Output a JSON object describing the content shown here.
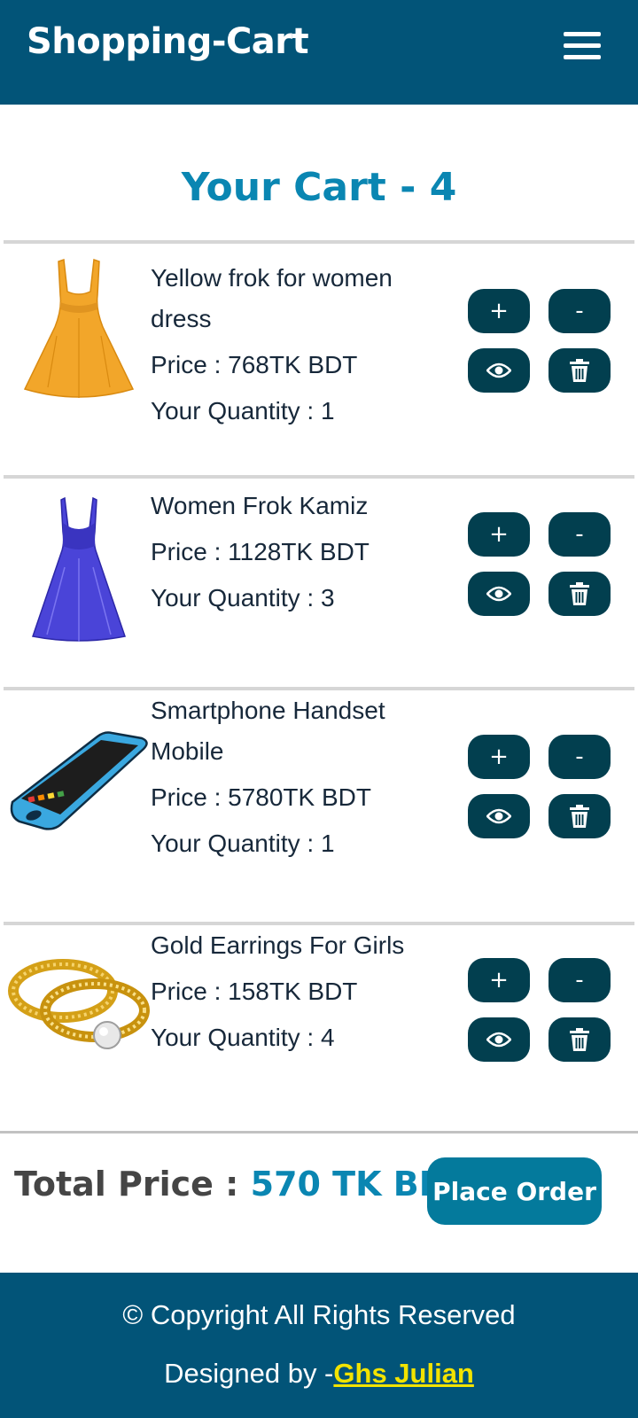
{
  "header": {
    "brand": "Shopping-Cart",
    "menu_icon": "hamburger-icon"
  },
  "cart": {
    "title": "Your Cart - 4"
  },
  "items": [
    {
      "name": "Yellow frok for women dress",
      "price": "Price : 768TK BDT",
      "quantity": "Your Quantity : 1",
      "image": "yellow-dress-image"
    },
    {
      "name": "Women Frok Kamiz",
      "price": "Price : 1128TK BDT",
      "quantity": "Your Quantity : 3",
      "image": "blue-gown-image"
    },
    {
      "name": "Smartphone Handset Mobile",
      "price": "Price : 5780TK BDT",
      "quantity": "Your Quantity : 1",
      "image": "smartphone-image"
    },
    {
      "name": "Gold Earrings For Girls",
      "price": "Price : 158TK BDT",
      "quantity": "Your Quantity : 4",
      "image": "gold-rings-image"
    }
  ],
  "buttons": {
    "plus": "+",
    "minus": "-",
    "view_icon": "eye-icon",
    "delete_icon": "trash-icon"
  },
  "total": {
    "label": "Total Price : ",
    "amount": "570 TK BDT"
  },
  "order": {
    "label": "Place Order"
  },
  "footer": {
    "copyright": "© Copyright All Rights Reserved",
    "designed_prefix": "Designed by -",
    "designer": "Ghs Julian"
  },
  "colors": {
    "navbar": "#025478",
    "accent": "#0a86b2",
    "button": "#023f4f",
    "order_button": "#047a9c",
    "designer_link": "#f2e300"
  }
}
